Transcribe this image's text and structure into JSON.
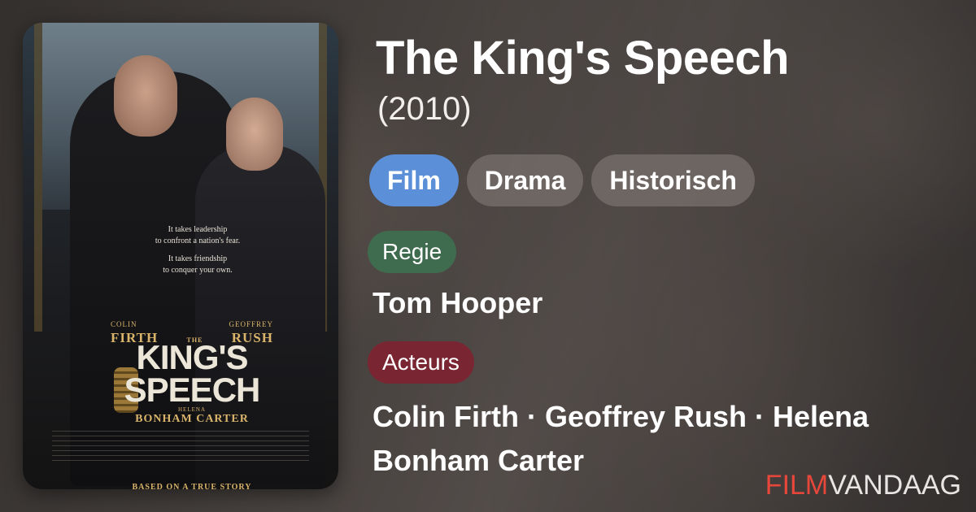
{
  "movie": {
    "title": "The King's Speech",
    "year": "(2010)"
  },
  "tags": [
    "Film",
    "Drama",
    "Historisch"
  ],
  "director": {
    "label": "Regie",
    "name": "Tom Hooper"
  },
  "actors": {
    "label": "Acteurs",
    "names": "Colin Firth · Geoffrey Rush · Helena Bonham Carter"
  },
  "brand": {
    "part1": "FILM",
    "part2": "VANDAAG"
  },
  "poster": {
    "tagline_1a": "It takes leadership",
    "tagline_1b": "to confront a nation's fear.",
    "tagline_2a": "It takes friendship",
    "tagline_2b": "to conquer your own.",
    "actor_left_first": "COLIN",
    "actor_right_first": "GEOFFREY",
    "actor_left_last": "FIRTH",
    "the": "THE",
    "actor_right_last": "RUSH",
    "title_line1": "KING'S",
    "title_line2": "SPEECH",
    "helena": "HELENA",
    "bonham_carter": "BONHAM CARTER",
    "bottom_line": "BASED ON A TRUE STORY"
  },
  "colors": {
    "tag_primary": "#5b8fd8",
    "chip_regie": "#3f6b4e",
    "chip_acteurs": "#7a2632",
    "brand_red": "#e6473a"
  }
}
